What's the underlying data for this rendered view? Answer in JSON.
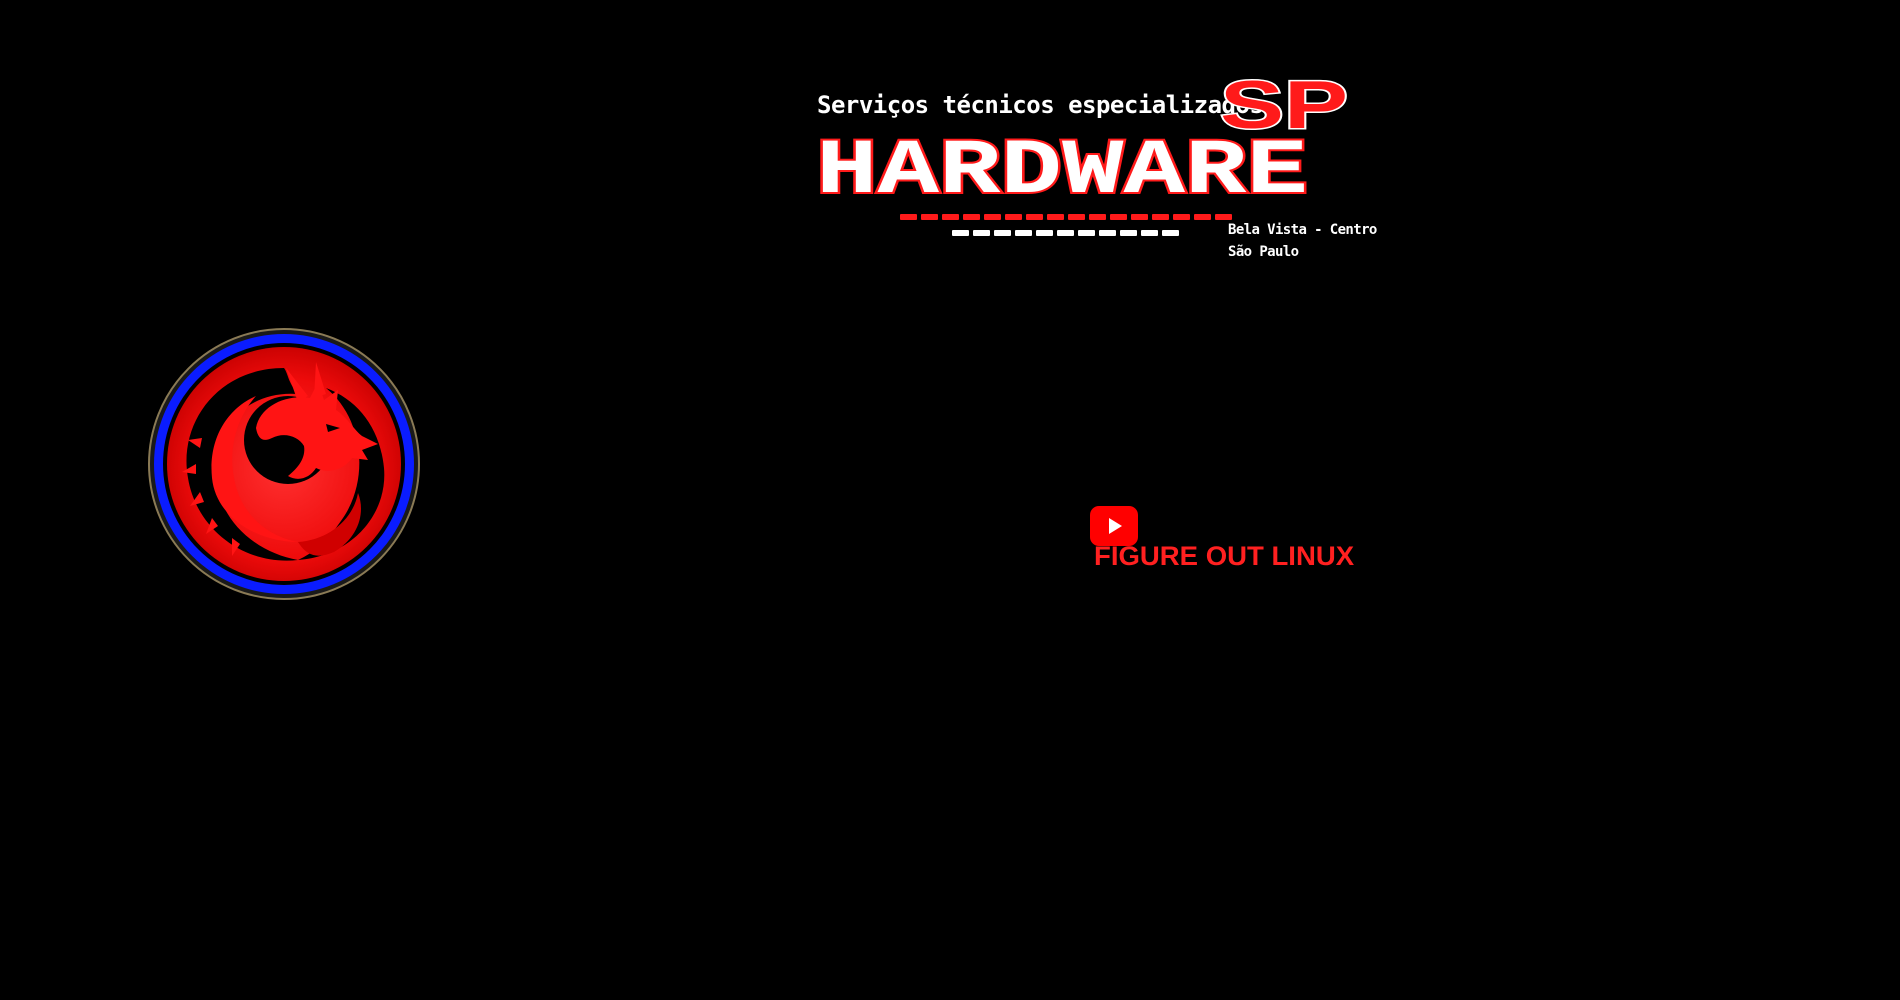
{
  "header": {
    "tagline": "Serviços técnicos especializados",
    "badge": "SP",
    "brand": "HARDWARE",
    "location_line1": "Bela Vista - Centro",
    "location_line2": "São Paulo"
  },
  "emblem": {
    "icon": "dragon-icon"
  },
  "channel": {
    "icon": "youtube-play-icon",
    "name": "FIGURE OUT LINUX"
  },
  "colors": {
    "background": "#000000",
    "accent_red": "#ff1a1a",
    "ring_blue": "#0a1cff",
    "text_white": "#ffffff"
  }
}
